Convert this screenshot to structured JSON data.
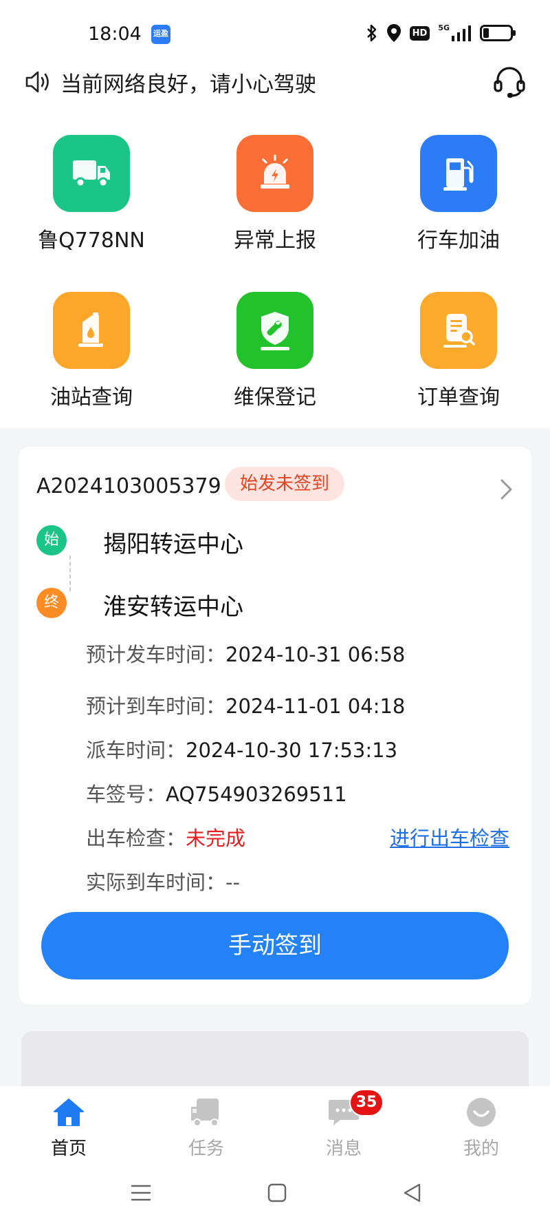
{
  "status_bar": {
    "time": "18:04",
    "app_badge": "运盈",
    "signal_label": "5G",
    "hd_label": "HD",
    "battery_level": 0.2
  },
  "notice": {
    "text": "当前网络良好，请小心驾驶"
  },
  "grid": [
    {
      "label": "鲁Q778NN",
      "icon": "truck-icon",
      "color": "#1bc587"
    },
    {
      "label": "异常上报",
      "icon": "alarm-icon",
      "color": "#fb6f36"
    },
    {
      "label": "行车加油",
      "icon": "fuel-pump-icon",
      "color": "#2b7cf6"
    },
    {
      "label": "油站查询",
      "icon": "oil-can-icon",
      "color": "#fca72a"
    },
    {
      "label": "维保登记",
      "icon": "wrench-shield-icon",
      "color": "#22c22d"
    },
    {
      "label": "订单查询",
      "icon": "order-search-icon",
      "color": "#fcaa2b"
    }
  ],
  "task_card": {
    "order_no": "A2024103005379",
    "status": "始发未签到",
    "origin_marker": "始",
    "origin": "揭阳转运中心",
    "dest_marker": "终",
    "destination": "淮安转运中心",
    "rows": {
      "planned_depart_label": "预计发车时间：",
      "planned_depart_value": "2024-10-31 06:58",
      "planned_arrive_label": "预计到车时间：",
      "planned_arrive_value": "2024-11-01 04:18",
      "dispatch_label": "派车时间：",
      "dispatch_value": "2024-10-30 17:53:13",
      "tag_label": "车签号：",
      "tag_value": "AQ754903269511",
      "check_label": "出车检查：",
      "check_value": "未完成",
      "check_link": "进行出车检查",
      "actual_arrive_label": "实际到车时间：",
      "actual_arrive_value": "--"
    },
    "button": "手动签到"
  },
  "tabs": [
    {
      "label": "首页",
      "icon": "home-icon",
      "active": true
    },
    {
      "label": "任务",
      "icon": "truck-icon"
    },
    {
      "label": "消息",
      "icon": "message-icon",
      "badge": "35"
    },
    {
      "label": "我的",
      "icon": "profile-icon"
    }
  ],
  "colors": {
    "primary": "#2482f8",
    "tag_bg": "#fde4e1",
    "tag_text": "#e2451f",
    "alert_red": "#e41f1f",
    "origin_green": "#1bc587",
    "dest_orange": "#fb8c23"
  }
}
